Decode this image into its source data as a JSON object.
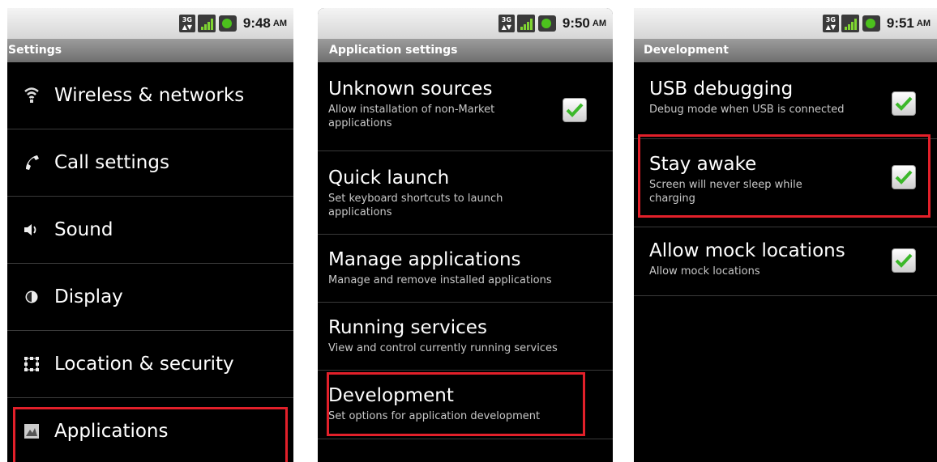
{
  "screens": [
    {
      "status_time": "9:48",
      "status_ampm": "AM",
      "title": "Settings",
      "items": [
        {
          "label": "Wireless & networks",
          "icon": "wifi-icon"
        },
        {
          "label": "Call settings",
          "icon": "phone-icon"
        },
        {
          "label": "Sound",
          "icon": "speaker-icon"
        },
        {
          "label": "Display",
          "icon": "brightness-icon"
        },
        {
          "label": "Location & security",
          "icon": "grid-lock-icon"
        },
        {
          "label": "Applications",
          "icon": "applications-icon",
          "highlighted": true
        }
      ]
    },
    {
      "status_time": "9:50",
      "status_ampm": "AM",
      "title": "Application settings",
      "items": [
        {
          "title": "Unknown sources",
          "summary": "Allow installation of non-Market applications",
          "checked": true
        },
        {
          "title": "Quick launch",
          "summary": "Set keyboard shortcuts to launch applications"
        },
        {
          "title": "Manage applications",
          "summary": "Manage and remove installed applications"
        },
        {
          "title": "Running services",
          "summary": "View and control currently running services"
        },
        {
          "title": "Development",
          "summary": "Set options for application development",
          "highlighted": true
        }
      ]
    },
    {
      "status_time": "9:51",
      "status_ampm": "AM",
      "title": "Development",
      "items": [
        {
          "title": "USB debugging",
          "summary": "Debug mode when USB is connected",
          "checked": true
        },
        {
          "title": "Stay awake",
          "summary": "Screen will never sleep while charging",
          "checked": true,
          "highlighted": true
        },
        {
          "title": "Allow mock locations",
          "summary": "Allow mock locations",
          "checked": true
        }
      ]
    }
  ],
  "status_icons": {
    "network": "3G",
    "signal": "signal-icon",
    "battery": "battery-icon"
  },
  "colors": {
    "highlight": "#e2202a",
    "check": "#3cb82a",
    "titlebar": "#7f7f7f"
  }
}
